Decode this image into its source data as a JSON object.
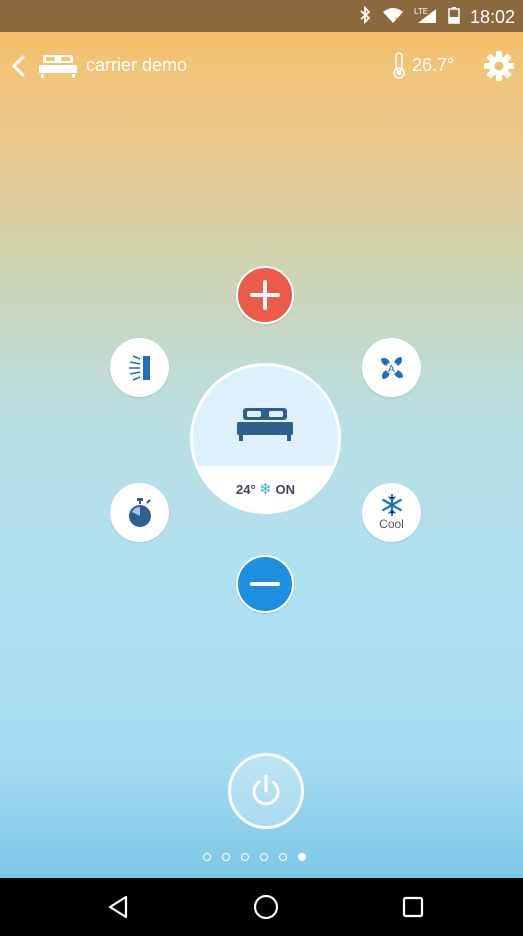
{
  "status_bar": {
    "time": "18:02",
    "icons": [
      "bluetooth-icon",
      "wifi-icon",
      "lte-signal-icon",
      "battery-icon"
    ]
  },
  "header": {
    "device_name": "carrier demo",
    "room_temperature": "26.7°"
  },
  "controls": {
    "set_temperature": "24°",
    "power_state": "ON",
    "mode_label": "Cool",
    "mode_symbol": "❄"
  },
  "pager": {
    "pages": 6,
    "active_index": 5
  },
  "colors": {
    "plus_button": "#ec5a49",
    "minus_button": "#1d8fe0",
    "icon_blue": "#1d6fbf",
    "bed_blue": "#2f5f8f"
  }
}
